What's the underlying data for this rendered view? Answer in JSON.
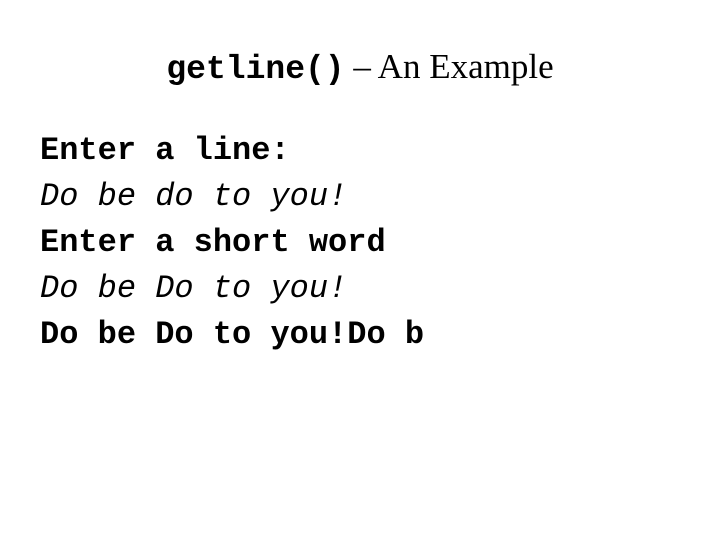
{
  "slide": {
    "background_color": "#ffffff",
    "text_color": "#000000",
    "title": {
      "code_part": "getline()",
      "rest_part": " – An Example",
      "full": "getline() – An Example"
    },
    "transcript": {
      "lines": [
        {
          "text": "Enter a line:",
          "kind": "output"
        },
        {
          "text": "Do be do to you!",
          "kind": "input"
        },
        {
          "text": "Enter a short word",
          "kind": "output"
        },
        {
          "text": "Do be Do to you!",
          "kind": "input"
        },
        {
          "text": "Do be Do to you!Do b",
          "kind": "output"
        }
      ]
    }
  }
}
